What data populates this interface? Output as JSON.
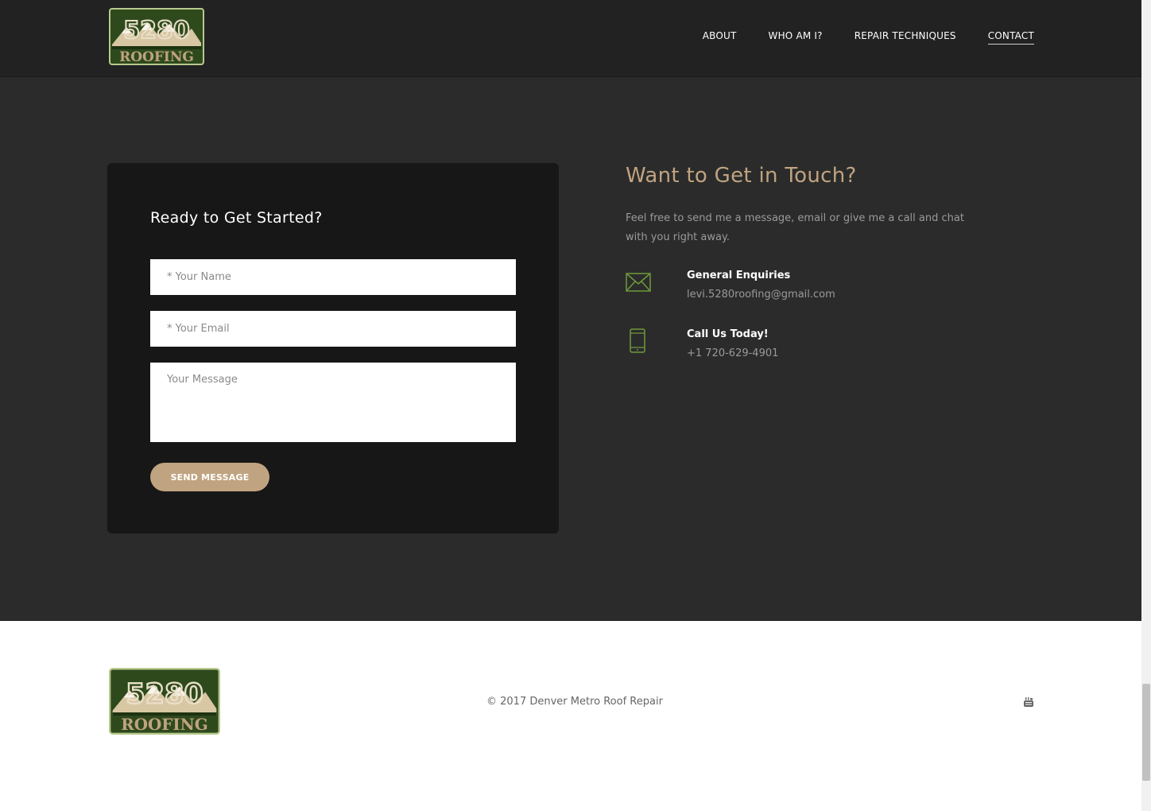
{
  "header": {
    "logo": {
      "number": "5280",
      "word": "ROOFING"
    },
    "nav": [
      {
        "label": "ABOUT"
      },
      {
        "label": "WHO AM I?"
      },
      {
        "label": "REPAIR TECHNIQUES"
      },
      {
        "label": "CONTACT",
        "active": true
      }
    ]
  },
  "form": {
    "title": "Ready to Get Started?",
    "name_placeholder": "* Your Name",
    "email_placeholder": "* Your Email",
    "message_placeholder": "Your Message",
    "send_label": "SEND MESSAGE"
  },
  "contact": {
    "title": "Want to Get in Touch?",
    "text": "Feel free to send me a message, email or give me a call and chat with you right away.",
    "email_icon": "envelope-icon",
    "email_label": "General Enquiries",
    "email_value": "levi.5280roofing@gmail.com",
    "phone_icon": "mobile-phone-icon",
    "phone_label": "Call Us Today!",
    "phone_value": "+1 720-629-4901"
  },
  "footer": {
    "copyright": "© 2017 Denver Metro Roof Repair",
    "social_icon": "youtube-icon"
  },
  "colors": {
    "accent": "#c0a380",
    "icon_green": "#6f9a3c",
    "header_bg": "#222222",
    "main_bg": "#2b2b2b",
    "card_bg": "#171717"
  }
}
